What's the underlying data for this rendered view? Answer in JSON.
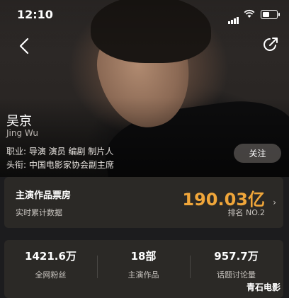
{
  "status_bar": {
    "time": "12:10"
  },
  "profile": {
    "name": "吴京",
    "pinyin": "Jing Wu",
    "occupation": "职业: 导演 演员 编剧 制片人",
    "title": "头衔: 中国电影家协会副主席",
    "follow_label": "关注"
  },
  "box_office": {
    "label": "主演作品票房",
    "subtitle": "实时累计数据",
    "value": "190.03亿",
    "rank": "排名 NO.2"
  },
  "stats": [
    {
      "value": "1421.6万",
      "label": "全网粉丝"
    },
    {
      "value": "18部",
      "label": "主演作品"
    },
    {
      "value": "957.7万",
      "label": "话题讨论量"
    }
  ],
  "watermark": "青石电影"
}
